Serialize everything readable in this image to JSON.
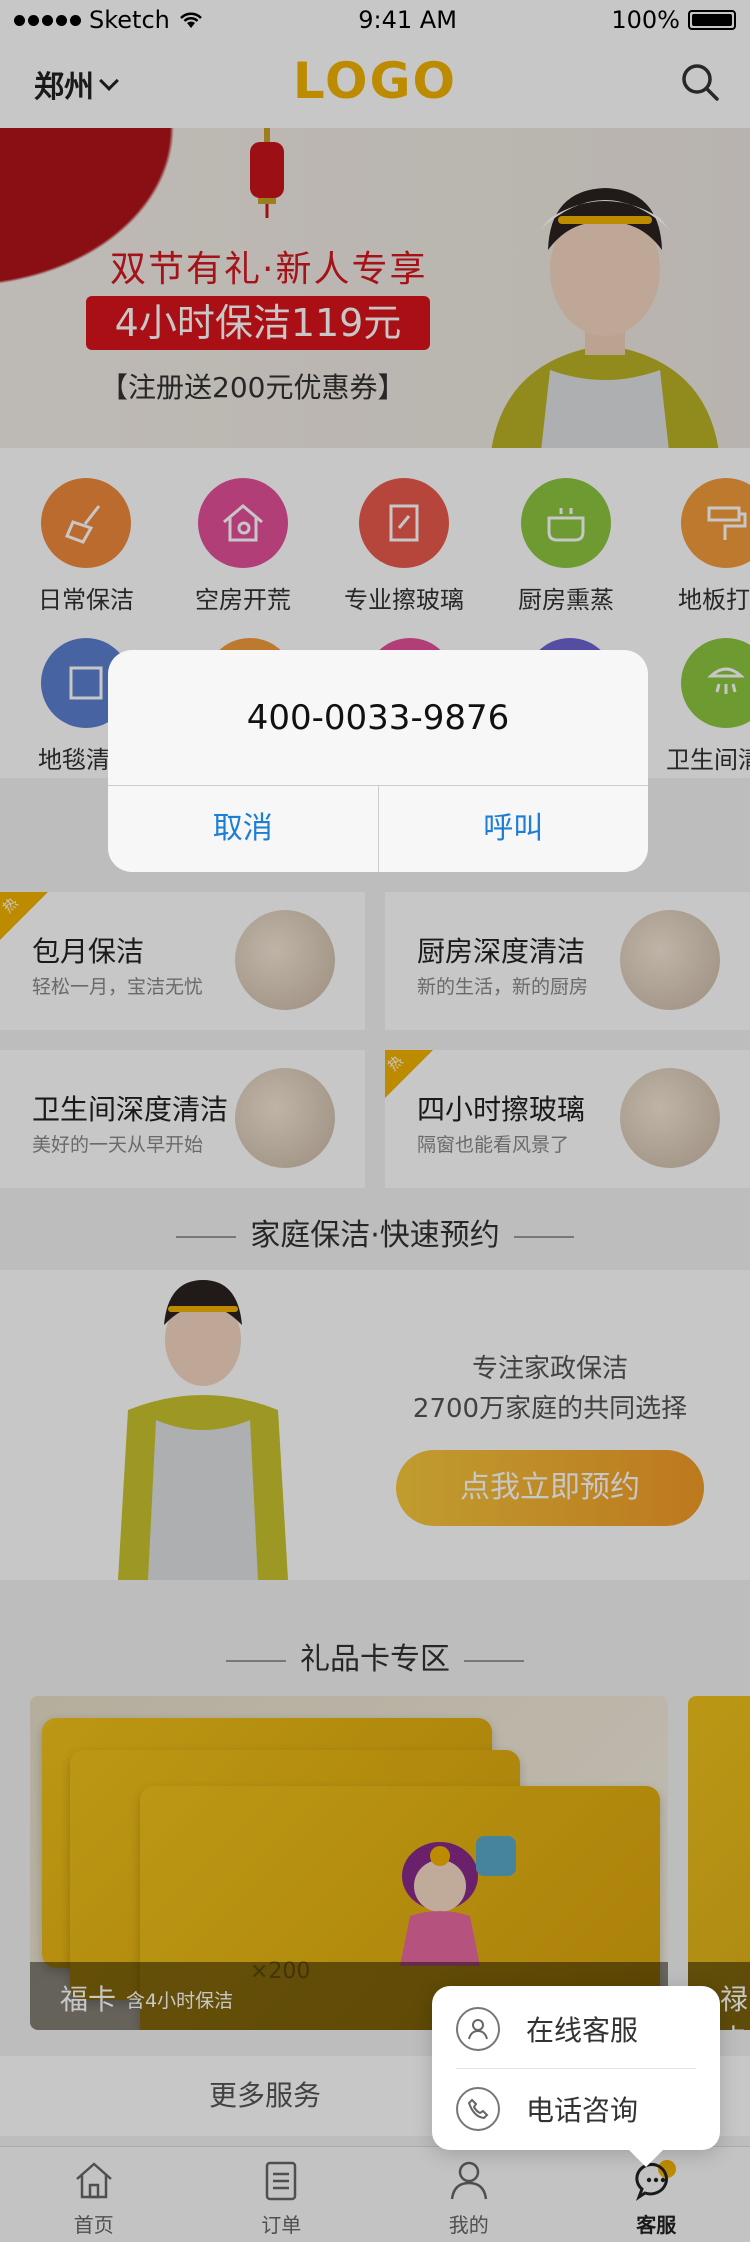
{
  "status_bar": {
    "carrier": "Sketch",
    "time": "9:41 AM",
    "battery": "100%"
  },
  "header": {
    "city": "郑州",
    "logo": "LOGO"
  },
  "banner": {
    "title": "双节有礼·新人专享",
    "price": "4小时保洁119元",
    "coupon": "【注册送200元优惠券】"
  },
  "services": [
    {
      "label": "日常保洁",
      "icon": "broom-icon",
      "color": "#f08a3c"
    },
    {
      "label": "空房开荒",
      "icon": "house-icon",
      "color": "#e4509a"
    },
    {
      "label": "专业擦玻璃",
      "icon": "window-icon",
      "color": "#ea5a4c"
    },
    {
      "label": "厨房熏蒸",
      "icon": "pot-icon",
      "color": "#8cc63f"
    },
    {
      "label": "地板打蜡",
      "icon": "roller-icon",
      "color": "#f29b3a"
    },
    {
      "label": "地毯清洗",
      "icon": "carpet-icon",
      "color": "#5b7fd0"
    },
    {
      "label": "卫生间清洁",
      "icon": "shower-icon",
      "color": "#8cc63f"
    }
  ],
  "cards": [
    {
      "title": "包月保洁",
      "subtitle": "轻松一月，宝洁无忧",
      "hot": true
    },
    {
      "title": "厨房深度清洁",
      "subtitle": "新的生活，新的厨房",
      "hot": false
    },
    {
      "title": "卫生间深度清洁",
      "subtitle": "美好的一天从早开始",
      "hot": false
    },
    {
      "title": "四小时擦玻璃",
      "subtitle": "隔窗也能看风景了",
      "hot": true
    }
  ],
  "hot_badge": "热",
  "booking": {
    "section_title": "家庭保洁·快速预约",
    "line1": "专注家政保洁",
    "line2": "2700万家庭的共同选择",
    "button": "点我立即预约"
  },
  "gift": {
    "section_title": "礼品卡专区",
    "card_name": "福卡",
    "card_desc": "含4小时保洁",
    "card_value": "×200",
    "next_card_name": "禄卡"
  },
  "more": "更多服务",
  "tabs": [
    {
      "label": "首页",
      "icon": "home-icon"
    },
    {
      "label": "订单",
      "icon": "order-icon"
    },
    {
      "label": "我的",
      "icon": "user-icon"
    },
    {
      "label": "客服",
      "icon": "chat-icon"
    }
  ],
  "alert": {
    "phone": "400-0033-9876",
    "cancel": "取消",
    "call": "呼叫"
  },
  "popup": {
    "online": "在线客服",
    "phone": "电话咨询"
  },
  "colors": {
    "brand": "#f2b300",
    "accent_red": "#d9141c",
    "link_blue": "#1c7ed6"
  }
}
